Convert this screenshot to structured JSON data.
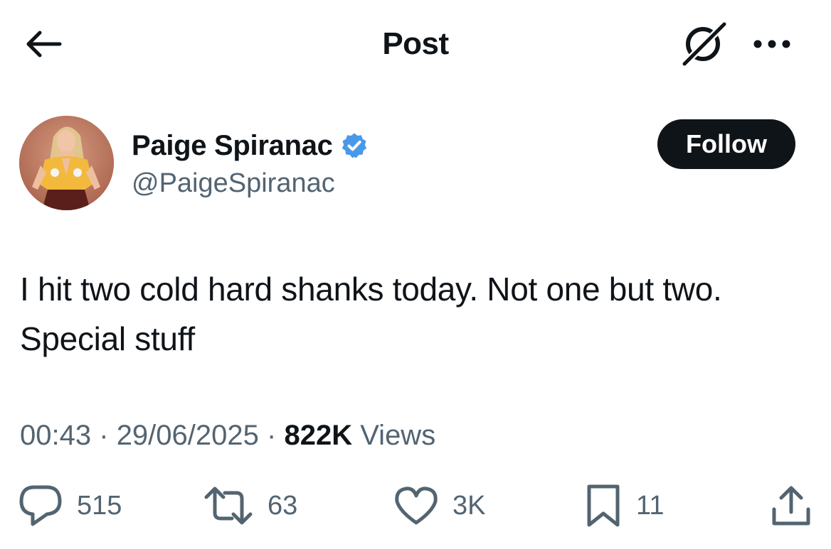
{
  "header": {
    "title": "Post",
    "icons": {
      "back": "arrow-left-icon",
      "grok": "grok-icon",
      "more": "more-dots-icon"
    }
  },
  "author": {
    "name": "Paige Spiranac",
    "handle": "@PaigeSpiranac",
    "verified": true,
    "verified_color": "#4a99e9",
    "follow_label": "Follow"
  },
  "post": {
    "text": "I hit two cold hard shanks today. Not one but two. Special stuff",
    "time": "00:43",
    "date": "29/06/2025",
    "separator": "·",
    "views_count": "822K",
    "views_label": "Views"
  },
  "actions": {
    "replies": "515",
    "reposts": "63",
    "likes": "3K",
    "bookmarks": "11"
  },
  "colors": {
    "text_primary": "#0f1419",
    "text_secondary": "#536471",
    "follow_bg": "#0f1419",
    "background": "#ffffff"
  }
}
